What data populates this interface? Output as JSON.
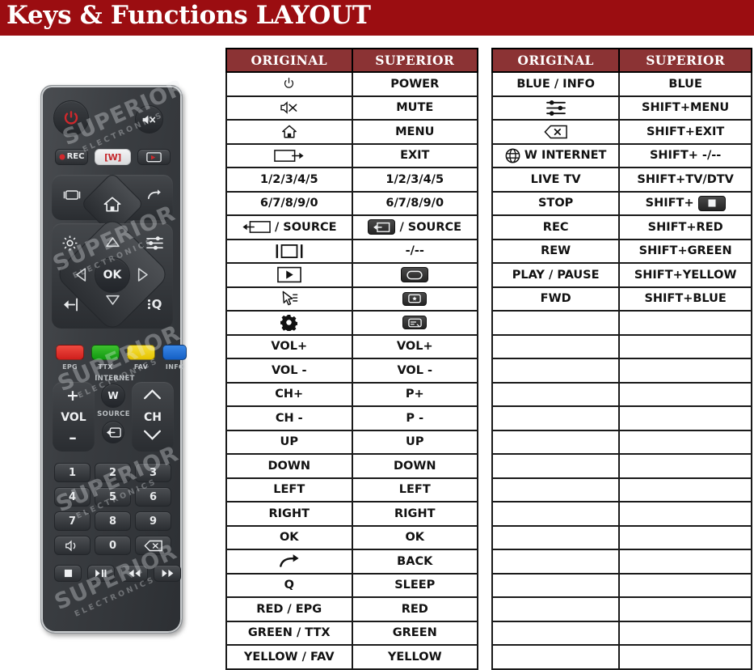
{
  "header": {
    "title": "Keys & Functions LAYOUT",
    "title_bg": "#9b0d11",
    "title_color": "#ffffff"
  },
  "colors": {
    "table_header_bg": "#8b3334",
    "table_border": "#1a1a1a",
    "accent_red": "#9b0d11",
    "remote_body": "#3d4044",
    "key_red": "#e12a28",
    "key_green": "#19a519",
    "key_yellow": "#efd000",
    "key_blue": "#1a6fd4"
  },
  "tables": [
    {
      "id": "table-1",
      "columns": [
        "ORIGINAL",
        "SUPERIOR"
      ],
      "rows": [
        {
          "original": {
            "icon": "power-icon"
          },
          "superior": {
            "text": "POWER"
          }
        },
        {
          "original": {
            "icon": "mute-icon"
          },
          "superior": {
            "text": "MUTE"
          }
        },
        {
          "original": {
            "icon": "home-icon"
          },
          "superior": {
            "text": "MENU"
          }
        },
        {
          "original": {
            "icon": "exit-icon"
          },
          "superior": {
            "text": "EXIT"
          }
        },
        {
          "original": {
            "text": "1/2/3/4/5"
          },
          "superior": {
            "text": "1/2/3/4/5"
          }
        },
        {
          "original": {
            "text": "6/7/8/9/0"
          },
          "superior": {
            "text": "6/7/8/9/0"
          }
        },
        {
          "original": {
            "icon": "source-in-icon",
            "text": "/ SOURCE"
          },
          "superior": {
            "icon": "source-keycap-icon",
            "text": "/ SOURCE"
          }
        },
        {
          "original": {
            "icon": "aspect-ratio-icon"
          },
          "superior": {
            "text": "-/--"
          }
        },
        {
          "original": {
            "icon": "play-box-icon"
          },
          "superior": {
            "icon": "keycap-oval-icon"
          }
        },
        {
          "original": {
            "icon": "cursor-icon"
          },
          "superior": {
            "icon": "keycap-star-icon"
          }
        },
        {
          "original": {
            "icon": "gear-icon"
          },
          "superior": {
            "icon": "keycap-subtitle-icon"
          }
        },
        {
          "original": {
            "text": "VOL+"
          },
          "superior": {
            "text": "VOL+"
          }
        },
        {
          "original": {
            "text": "VOL -"
          },
          "superior": {
            "text": "VOL -"
          }
        },
        {
          "original": {
            "text": "CH+"
          },
          "superior": {
            "text": "P+"
          }
        },
        {
          "original": {
            "text": "CH -"
          },
          "superior": {
            "text": "P -"
          }
        },
        {
          "original": {
            "text": "UP"
          },
          "superior": {
            "text": "UP"
          }
        },
        {
          "original": {
            "text": "DOWN"
          },
          "superior": {
            "text": "DOWN"
          }
        },
        {
          "original": {
            "text": "LEFT"
          },
          "superior": {
            "text": "LEFT"
          }
        },
        {
          "original": {
            "text": "RIGHT"
          },
          "superior": {
            "text": "RIGHT"
          }
        },
        {
          "original": {
            "text": "OK"
          },
          "superior": {
            "text": "OK"
          }
        },
        {
          "original": {
            "icon": "back-arrow-icon"
          },
          "superior": {
            "text": "BACK"
          }
        },
        {
          "original": {
            "text": "Q"
          },
          "superior": {
            "text": "SLEEP"
          }
        },
        {
          "original": {
            "text": "RED / EPG"
          },
          "superior": {
            "text": "RED"
          }
        },
        {
          "original": {
            "text": "GREEN / TTX"
          },
          "superior": {
            "text": "GREEN"
          }
        },
        {
          "original": {
            "text": "YELLOW / FAV"
          },
          "superior": {
            "text": "YELLOW"
          }
        }
      ]
    },
    {
      "id": "table-2",
      "columns": [
        "ORIGINAL",
        "SUPERIOR"
      ],
      "rows": [
        {
          "original": {
            "text": "BLUE / INFO"
          },
          "superior": {
            "text": "BLUE"
          }
        },
        {
          "original": {
            "icon": "sliders-icon"
          },
          "superior": {
            "text": "SHIFT+MENU"
          }
        },
        {
          "original": {
            "icon": "backspace-icon"
          },
          "superior": {
            "text": "SHIFT+EXIT"
          }
        },
        {
          "original": {
            "icon": "globe-icon",
            "text": "W INTERNET"
          },
          "superior": {
            "text": "SHIFT+ -/--"
          }
        },
        {
          "original": {
            "text": "LIVE TV"
          },
          "superior": {
            "text": "SHIFT+TV/DTV"
          }
        },
        {
          "original": {
            "text": "STOP"
          },
          "superior": {
            "text": "SHIFT+",
            "icon_after": "keycap-stop-icon"
          }
        },
        {
          "original": {
            "text": "REC"
          },
          "superior": {
            "text": "SHIFT+RED"
          }
        },
        {
          "original": {
            "text": "REW"
          },
          "superior": {
            "text": "SHIFT+GREEN"
          }
        },
        {
          "original": {
            "text": "PLAY / PAUSE"
          },
          "superior": {
            "text": "SHIFT+YELLOW"
          }
        },
        {
          "original": {
            "text": "FWD"
          },
          "superior": {
            "text": "SHIFT+BLUE"
          }
        },
        {
          "original": {},
          "superior": {}
        },
        {
          "original": {},
          "superior": {}
        },
        {
          "original": {},
          "superior": {}
        },
        {
          "original": {},
          "superior": {}
        },
        {
          "original": {},
          "superior": {}
        },
        {
          "original": {},
          "superior": {}
        },
        {
          "original": {},
          "superior": {}
        },
        {
          "original": {},
          "superior": {}
        },
        {
          "original": {},
          "superior": {}
        },
        {
          "original": {},
          "superior": {}
        },
        {
          "original": {},
          "superior": {}
        },
        {
          "original": {},
          "superior": {}
        },
        {
          "original": {},
          "superior": {}
        },
        {
          "original": {},
          "superior": {}
        },
        {
          "original": {},
          "superior": {}
        }
      ]
    }
  ],
  "remote": {
    "name": "tv-remote-control",
    "watermark": {
      "line1": "SUPERIOR",
      "line2": "ELECTRONICS"
    },
    "keys": {
      "power": "power-icon",
      "mute": "mute-icon",
      "rec": "REC",
      "w_internet": "[W]",
      "live_tv": "live-tv-icon",
      "aspect": "aspect-ratio-icon",
      "home": "home-icon",
      "back": "back-arrow-icon",
      "settings": "gear-icon",
      "sliders": "sliders-icon",
      "up": "up-arrow-icon",
      "down": "down-arrow-icon",
      "left": "left-arrow-icon",
      "right": "right-arrow-icon",
      "ok": "OK",
      "exit": "exit-icon",
      "search": "Q",
      "vol": "VOL",
      "vol_plus": "+",
      "vol_minus": "–",
      "ch": "CH",
      "source": "source-in-icon",
      "internet_label": "INTERNET",
      "source_label": "SOURCE",
      "w_button": "W",
      "numbers": [
        "1",
        "2",
        "3",
        "4",
        "5",
        "6",
        "7",
        "8",
        "9",
        "0"
      ],
      "audio": "audio-icon",
      "delete": "backspace-icon",
      "stop": "stop-icon",
      "play_pause": "play-pause-icon",
      "rewind": "rewind-icon",
      "forward": "forward-icon"
    },
    "color_key_labels": [
      "EPG",
      "TTX",
      "FAV",
      "INFO"
    ]
  }
}
